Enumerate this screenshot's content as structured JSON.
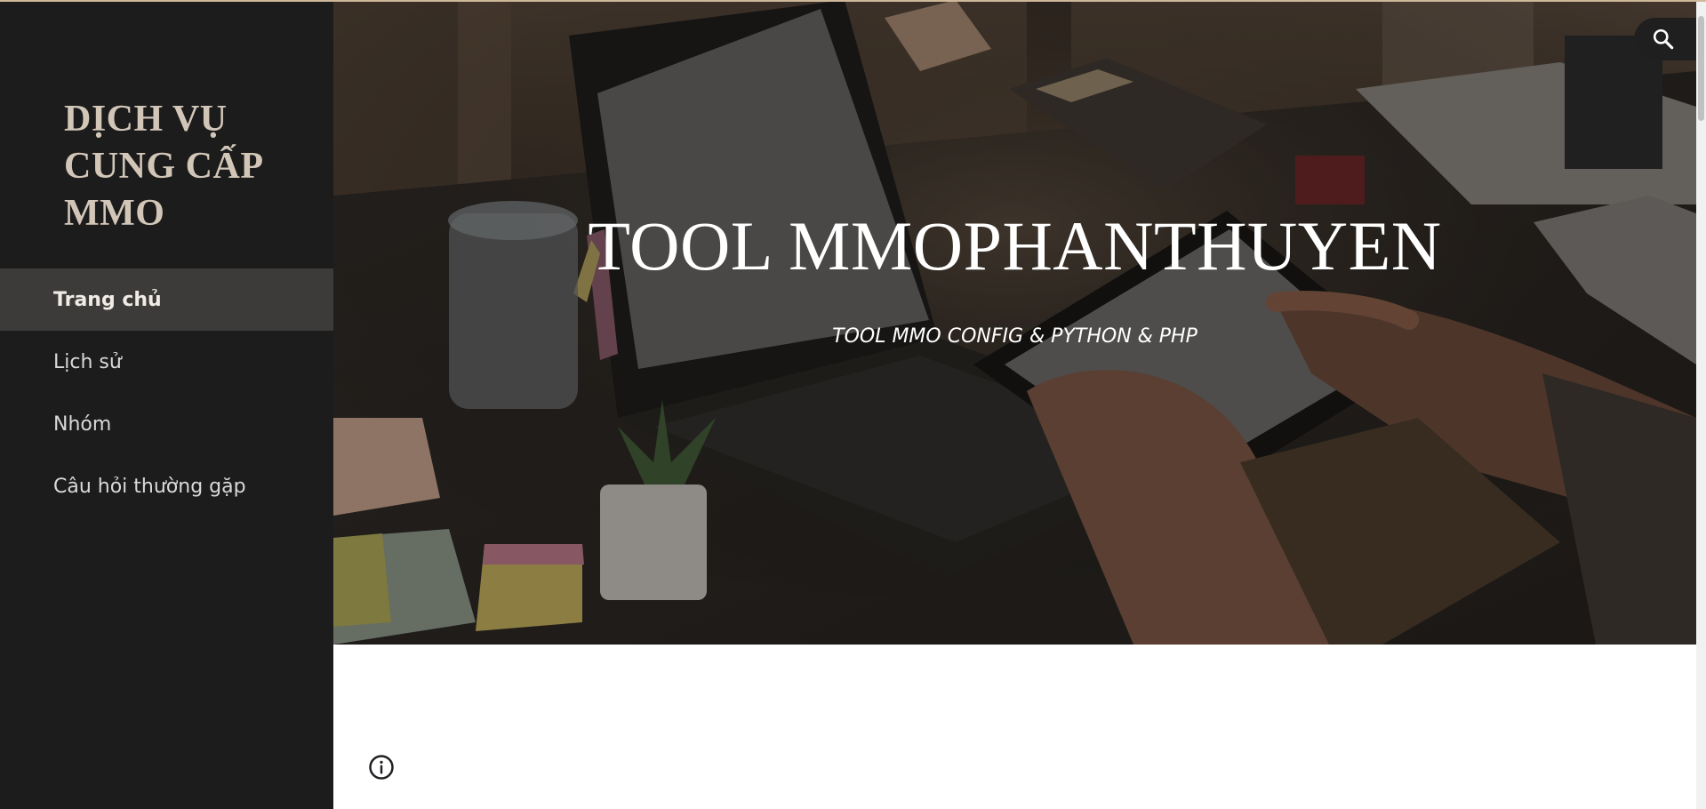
{
  "site": {
    "title": "DỊCH VỤ\nCUNG CẤP\nMMO"
  },
  "nav": {
    "items": [
      {
        "label": "Trang chủ",
        "active": true
      },
      {
        "label": "Lịch sử",
        "active": false
      },
      {
        "label": "Nhóm",
        "active": false
      },
      {
        "label": "Câu hỏi thường gặp",
        "active": false
      }
    ]
  },
  "hero": {
    "title": "TOOL MMOPHANTHUYEN",
    "subtitle": "TOOL MMO CONFIG & PYTHON & PHP"
  },
  "icons": {
    "search": "search-icon",
    "info": "info-icon"
  },
  "colors": {
    "sidebar_bg": "#1c1c1c",
    "sidebar_active_bg": "#3d3b39",
    "site_title": "#d2c6b8",
    "top_accent": "#cfb89a"
  }
}
